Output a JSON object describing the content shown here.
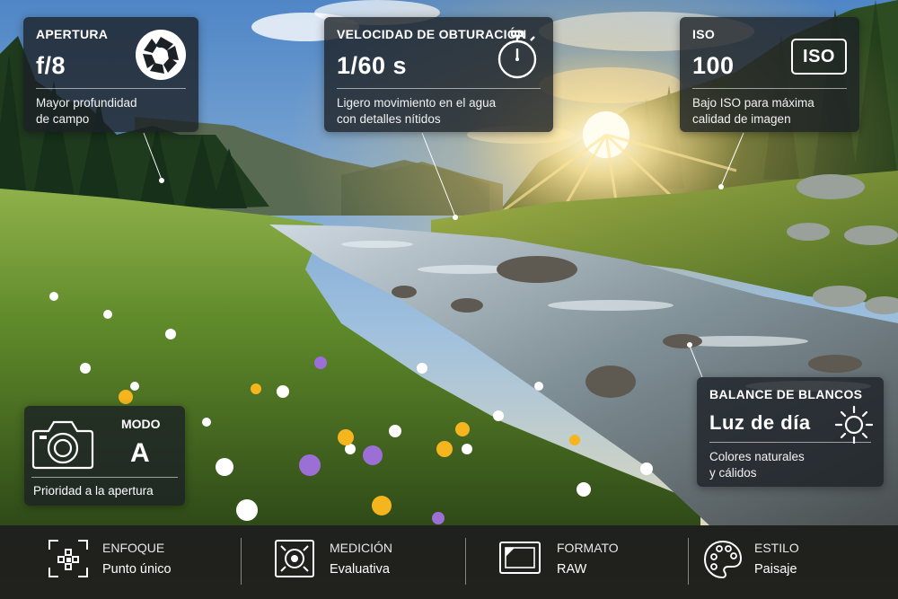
{
  "cards": {
    "aperture": {
      "label": "APERTURA",
      "value": "f/8",
      "description_line1": "Mayor profundidad",
      "description_line2": "de campo",
      "icon": "aperture-icon"
    },
    "shutter": {
      "label": "VELOCIDAD DE OBTURACIÓN",
      "value": "1/60 s",
      "description_line1": "Ligero movimiento en el agua",
      "description_line2": "con detalles nítidos",
      "icon": "stopwatch-icon"
    },
    "iso": {
      "label": "ISO",
      "value": "100",
      "badge": "ISO",
      "description_line1": "Bajo ISO para máxima",
      "description_line2": "calidad de imagen"
    },
    "white_balance": {
      "label": "BALANCE DE BLANCOS",
      "value": "Luz de día",
      "description_line1": "Colores naturales",
      "description_line2": "y cálidos",
      "icon": "sun-icon"
    },
    "mode": {
      "label": "MODO",
      "value": "A",
      "description": "Prioridad a la apertura",
      "icon": "camera-icon"
    }
  },
  "bottom_bar": {
    "items": [
      {
        "title": "ENFOQUE",
        "value": "Punto único",
        "icon": "focus-point-icon"
      },
      {
        "title": "MEDICIÓN",
        "value": "Evaluativa",
        "icon": "metering-icon"
      },
      {
        "title": "FORMATO",
        "value": "RAW",
        "icon": "raw-format-icon"
      },
      {
        "title": "ESTILO",
        "value": "Paisaje",
        "icon": "palette-icon"
      }
    ]
  },
  "colors": {
    "card_background": "#1c2126",
    "bar_background": "#0a0c0c",
    "text": "#ffffff",
    "sky": "#5b8fc9",
    "sun": "#ffe9a8",
    "grass": "#5f8a2a"
  }
}
